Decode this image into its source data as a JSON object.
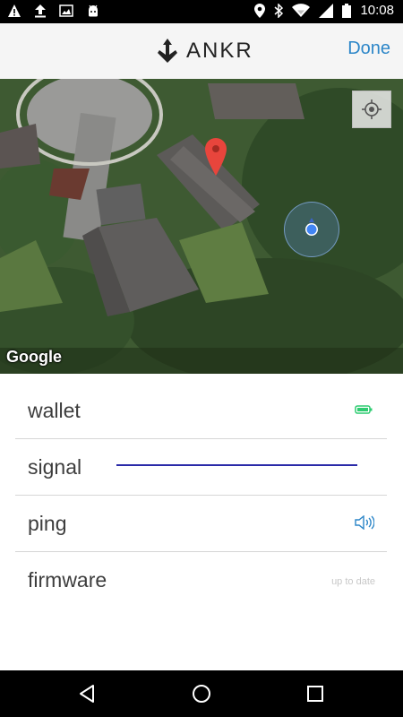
{
  "status_bar": {
    "time": "10:08",
    "left_icons": [
      "warning-icon",
      "upload-icon",
      "image-icon",
      "android-icon"
    ],
    "right_icons": [
      "location-icon",
      "bluetooth-icon",
      "wifi-icon",
      "signal-icon",
      "battery-icon"
    ]
  },
  "header": {
    "brand": "ANKR",
    "done_label": "Done"
  },
  "map": {
    "attribution": "Google",
    "colors": {
      "pin": "#e8453c",
      "location_dot": "#4285f4"
    }
  },
  "details": {
    "rows": [
      {
        "label": "wallet",
        "indicator": "battery-icon",
        "indicator_color": "#2ecc71"
      },
      {
        "label": "signal",
        "indicator": "signal-line",
        "indicator_color": "#2a2aa8"
      },
      {
        "label": "ping",
        "indicator": "speaker-icon",
        "indicator_color": "#2c86c8"
      },
      {
        "label": "firmware",
        "status": "up to date"
      }
    ]
  },
  "accent_color": "#2c86c8"
}
